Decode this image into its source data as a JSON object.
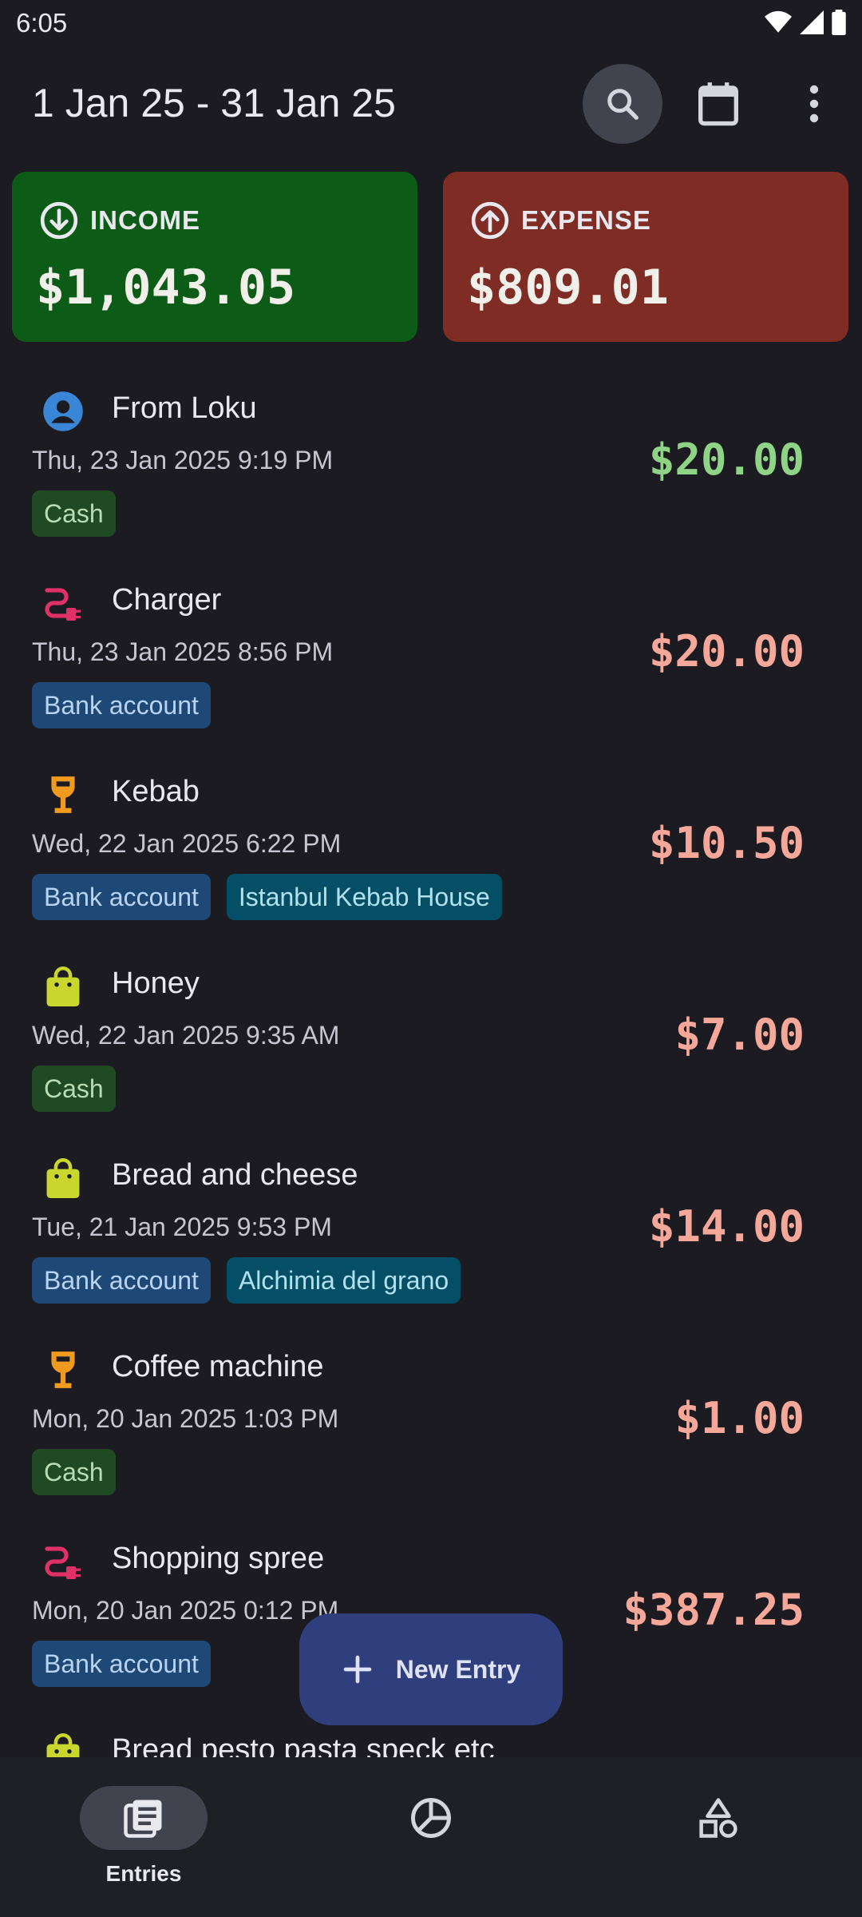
{
  "status": {
    "time": "6:05"
  },
  "header": {
    "date_range": "1 Jan 25 - 31 Jan 25"
  },
  "summary": {
    "income": {
      "label": "INCOME",
      "amount": "$1,043.05",
      "color": "#0c5b16"
    },
    "expense": {
      "label": "EXPENSE",
      "amount": "$809.01",
      "color": "#7e2c24"
    }
  },
  "entries": [
    {
      "title": "From Loku",
      "date": "Thu, 23 Jan 2025 9:19 PM",
      "amount": "$20.00",
      "type": "income",
      "icon": "person-icon",
      "tags": [
        "Cash"
      ]
    },
    {
      "title": "Charger",
      "date": "Thu, 23 Jan 2025 8:56 PM",
      "amount": "$20.00",
      "type": "expense",
      "icon": "plug-icon",
      "tags": [
        "Bank account"
      ]
    },
    {
      "title": "Kebab",
      "date": "Wed, 22 Jan 2025 6:22 PM",
      "amount": "$10.50",
      "type": "expense",
      "icon": "wine-glass-icon",
      "tags": [
        "Bank account",
        "Istanbul Kebab House"
      ]
    },
    {
      "title": "Honey",
      "date": "Wed, 22 Jan 2025 9:35 AM",
      "amount": "$7.00",
      "type": "expense",
      "icon": "shopping-bag-icon",
      "tags": [
        "Cash"
      ]
    },
    {
      "title": "Bread and cheese",
      "date": "Tue, 21 Jan 2025 9:53 PM",
      "amount": "$14.00",
      "type": "expense",
      "icon": "shopping-bag-icon",
      "tags": [
        "Bank account",
        "Alchimia del grano"
      ]
    },
    {
      "title": "Coffee machine",
      "date": "Mon, 20 Jan 2025 1:03 PM",
      "amount": "$1.00",
      "type": "expense",
      "icon": "wine-glass-icon",
      "tags": [
        "Cash"
      ]
    },
    {
      "title": "Shopping spree",
      "date": "Mon, 20 Jan 2025 0:12 PM",
      "amount": "$387.25",
      "type": "expense",
      "icon": "plug-icon",
      "tags": [
        "Bank account"
      ]
    },
    {
      "title": "Bread pesto pasta speck etc",
      "date": "",
      "amount": "",
      "type": "expense",
      "icon": "shopping-bag-icon",
      "tags": []
    }
  ],
  "fab": {
    "label": "New Entry"
  },
  "nav": {
    "entries_label": "Entries"
  }
}
